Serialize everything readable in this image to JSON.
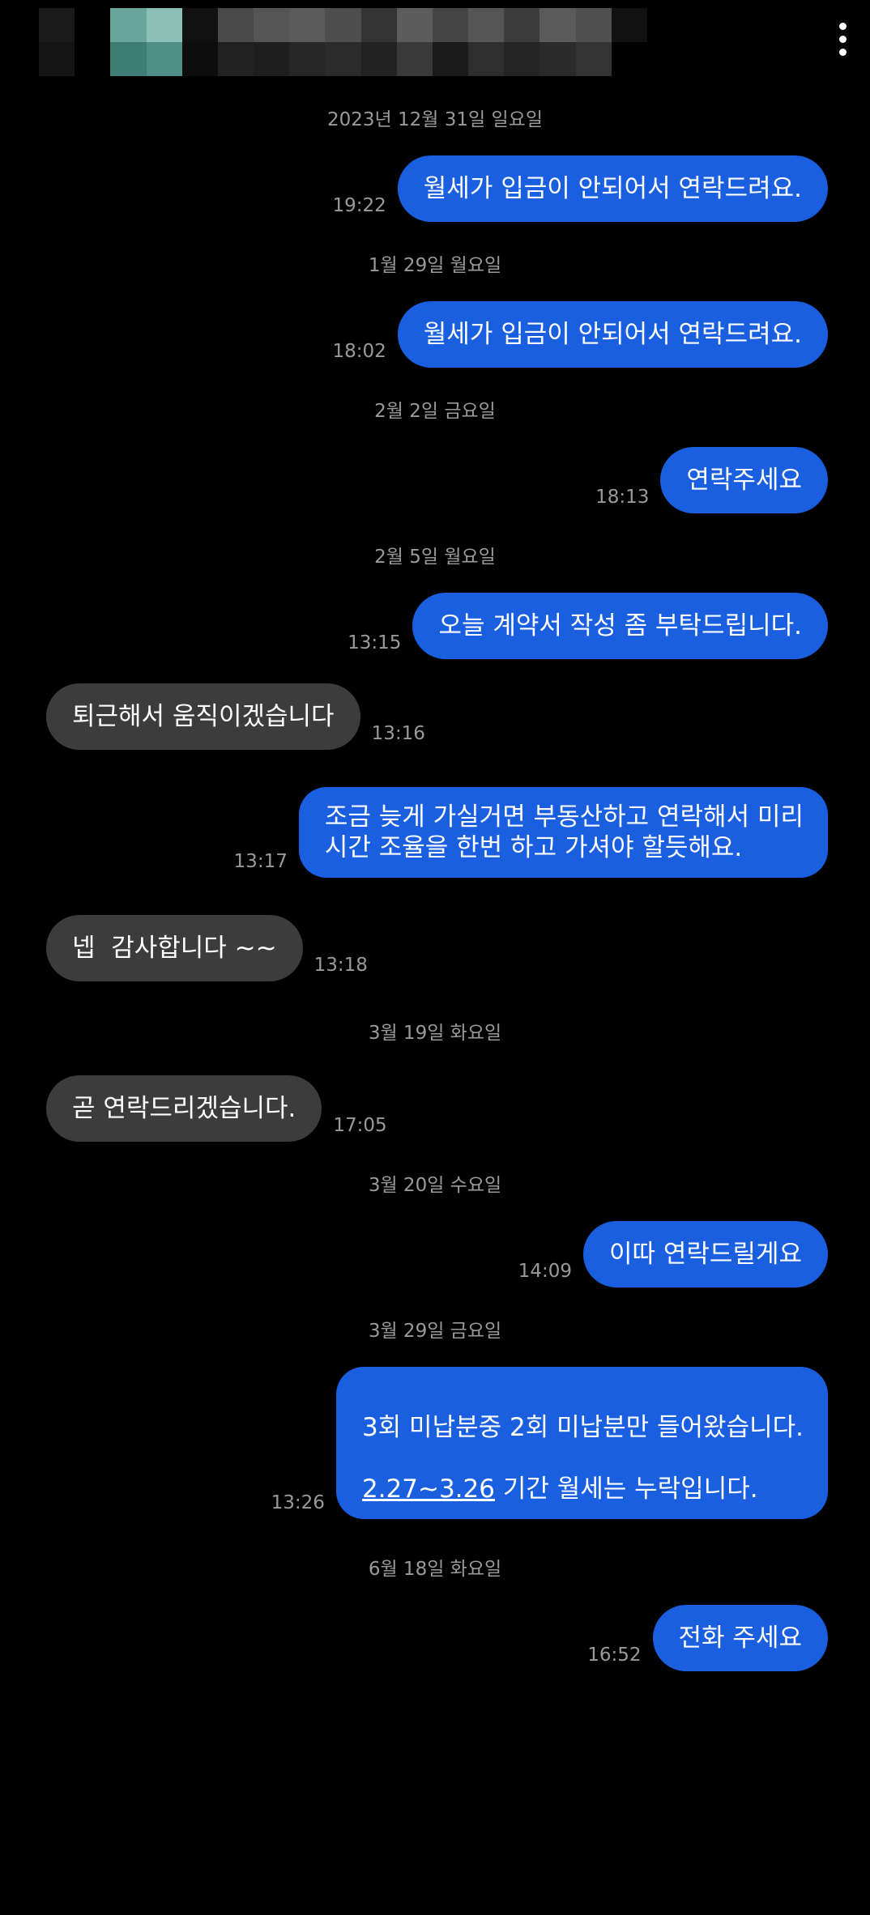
{
  "header": {
    "more_icon": "more-vertical-icon"
  },
  "messages": [
    {
      "kind": "date",
      "text": "2023년 12월 31일 일요일"
    },
    {
      "kind": "out",
      "text": "월세가 입금이 안되어서 연락드려요.",
      "time": "19:22"
    },
    {
      "kind": "date",
      "text": "1월 29일 월요일"
    },
    {
      "kind": "out",
      "text": "월세가 입금이 안되어서 연락드려요.",
      "time": "18:02"
    },
    {
      "kind": "date",
      "text": "2월 2일 금요일"
    },
    {
      "kind": "out",
      "text": "연락주세요",
      "time": "18:13"
    },
    {
      "kind": "date",
      "text": "2월 5일 월요일"
    },
    {
      "kind": "out",
      "text": "오늘 계약서 작성 좀 부탁드립니다.",
      "time": "13:15"
    },
    {
      "kind": "in",
      "text": "퇴근해서 움직이겠습니다",
      "time": "13:16"
    },
    {
      "kind": "out",
      "text": "조금 늦게 가실거면 부동산하고 연락해서 미리\n시간 조율을 한번 하고 가셔야 할듯해요.",
      "time": "13:17"
    },
    {
      "kind": "in",
      "text": "넵  감사합니다 ~~",
      "time": "13:18"
    },
    {
      "kind": "date",
      "text": "3월 19일 화요일"
    },
    {
      "kind": "in",
      "text": "곧 연락드리겠습니다.",
      "time": "17:05"
    },
    {
      "kind": "date",
      "text": "3월 20일 수요일"
    },
    {
      "kind": "out",
      "text": "이따 연락드릴게요",
      "time": "14:09"
    },
    {
      "kind": "date",
      "text": "3월 29일 금요일"
    },
    {
      "kind": "out",
      "text": "3회 미납분중 2회 미납분만 들어왔습니다.",
      "link": "2.27~3.26",
      "text2": " 기간 월세는 누락입니다.",
      "time": "13:26"
    },
    {
      "kind": "date",
      "text": "6월 18일 화요일"
    },
    {
      "kind": "out",
      "text": "전화 주세요",
      "time": "16:52"
    }
  ],
  "colors": {
    "background": "#000000",
    "outgoing_bubble": "#1a5fe0",
    "incoming_bubble": "#3c3c3c",
    "meta_text": "#9a9a9a"
  }
}
